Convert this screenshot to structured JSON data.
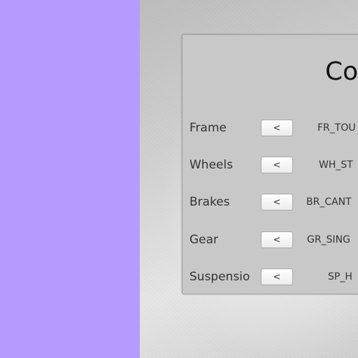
{
  "colors": {
    "left_panel": "#b69bff",
    "panel_bg": "#c8c8c8"
  },
  "config": {
    "title": "Co",
    "prev_icon": "<",
    "rows": [
      {
        "label": "Frame",
        "value": "FR_TOU"
      },
      {
        "label": "Wheels",
        "value": "WH_ST"
      },
      {
        "label": "Brakes",
        "value": "BR_CANT"
      },
      {
        "label": "Gear",
        "value": "GR_SING"
      },
      {
        "label": "Suspensio",
        "value": "SP_H"
      }
    ]
  }
}
